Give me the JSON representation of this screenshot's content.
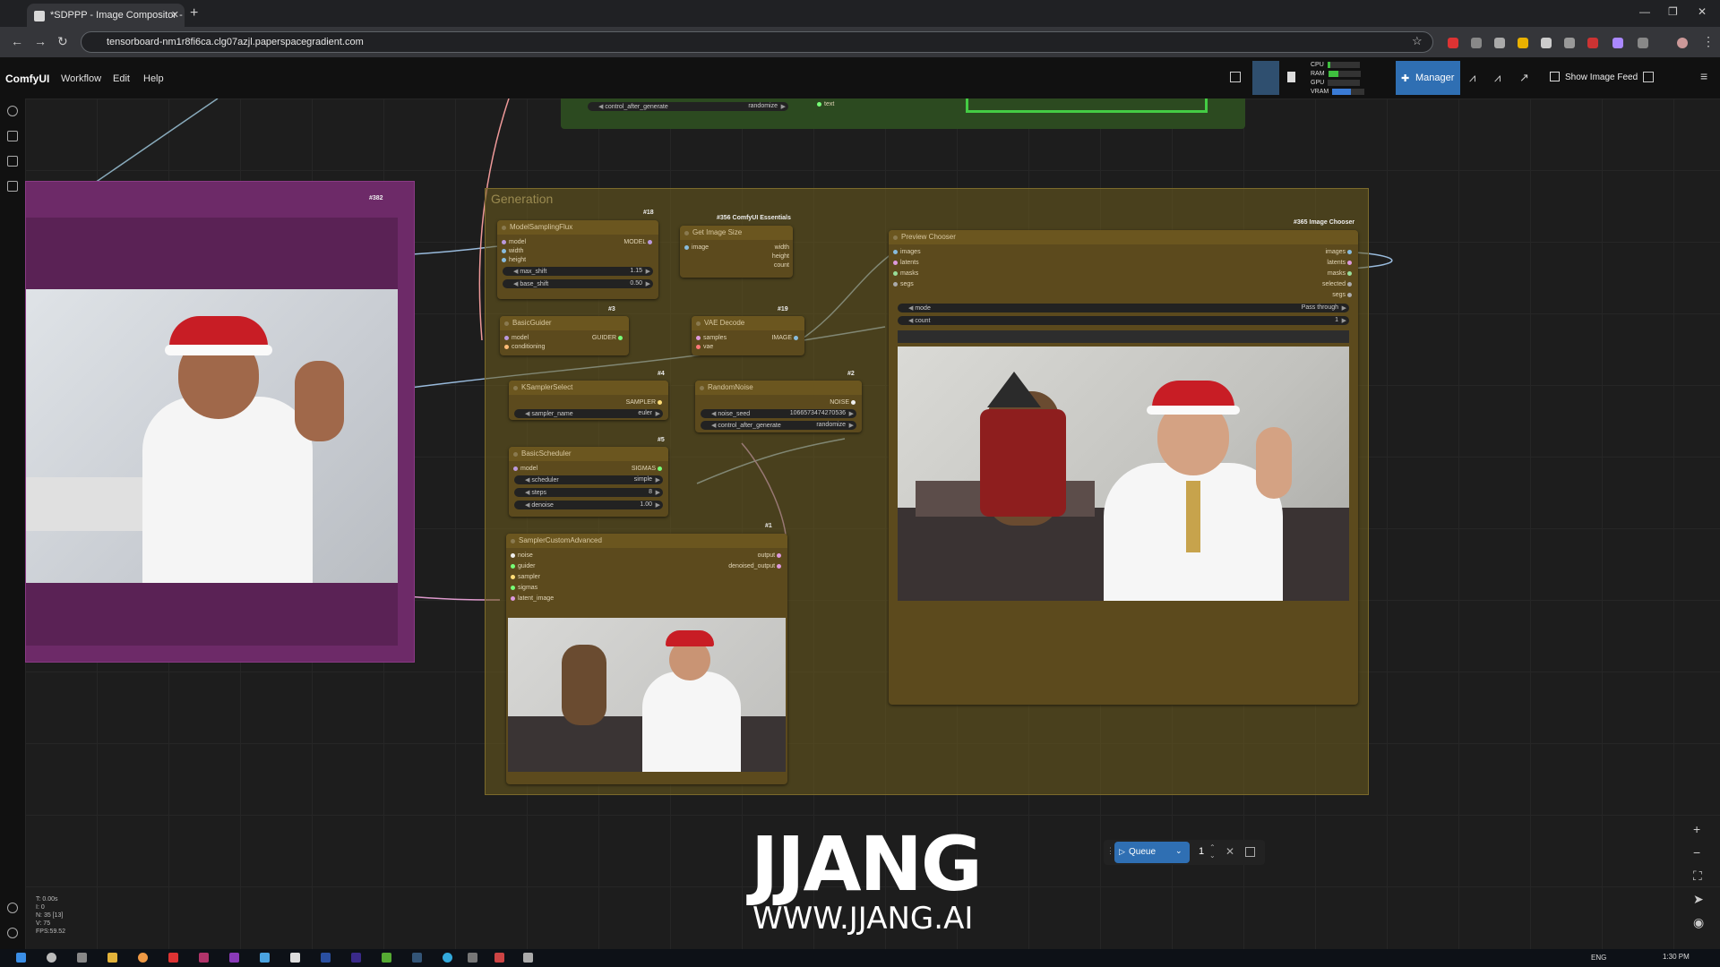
{
  "browser": {
    "tab_title": "*SDPPP - Image Compositor - C",
    "url": "tensorboard-nm1r8fi6ca.clg07azjl.paperspacegradient.com"
  },
  "menu": {
    "logo": "ComfyUI",
    "items": [
      "Workflow",
      "Edit",
      "Help"
    ],
    "stats": [
      {
        "label": "CPU",
        "value": "9%",
        "fraction": 0.09,
        "color": "#3fbf3f"
      },
      {
        "label": "RAM",
        "value": "32%",
        "fraction": 0.32,
        "color": "#3fbf3f"
      },
      {
        "label": "GPU",
        "value": "0%",
        "fraction": 0.0,
        "color": "#3fbf3f"
      },
      {
        "label": "VRAM",
        "value": "58%",
        "fraction": 0.58,
        "color": "#3a7bd5"
      }
    ],
    "manager_label": "Manager",
    "image_feed_label": "Show Image Feed"
  },
  "top_strip": {
    "control_after_generate": "control_after_generate",
    "control_value": "randomize",
    "text_label": "text"
  },
  "left_node": {
    "id": "#382"
  },
  "generation_group": {
    "title": "Generation"
  },
  "nodes": {
    "model_sampling": {
      "id": "#18",
      "title": "ModelSamplingFlux",
      "inputs": [
        "model",
        "width",
        "height"
      ],
      "output": "MODEL",
      "widgets": [
        {
          "label": "max_shift",
          "value": "1.15"
        },
        {
          "label": "base_shift",
          "value": "0.50"
        }
      ]
    },
    "get_image_size": {
      "id": "#356 ComfyUI Essentials",
      "title": "Get Image Size",
      "inputs": [
        "image"
      ],
      "outputs": [
        "width",
        "height",
        "count"
      ]
    },
    "basic_guider": {
      "id": "#3",
      "title": "BasicGuider",
      "inputs": [
        "model",
        "conditioning"
      ],
      "output": "GUIDER"
    },
    "vae_decode": {
      "id": "#19",
      "title": "VAE Decode",
      "inputs": [
        "samples",
        "vae"
      ],
      "output": "IMAGE"
    },
    "ksampler_select": {
      "id": "#4",
      "title": "KSamplerSelect",
      "output": "SAMPLER",
      "widgets": [
        {
          "label": "sampler_name",
          "value": "euler"
        }
      ]
    },
    "random_noise": {
      "id": "#2",
      "title": "RandomNoise",
      "output": "NOISE",
      "widgets": [
        {
          "label": "noise_seed",
          "value": "1066573474270536"
        },
        {
          "label": "control_after_generate",
          "value": "randomize"
        }
      ]
    },
    "basic_scheduler": {
      "id": "#5",
      "title": "BasicScheduler",
      "inputs": [
        "model"
      ],
      "output": "SIGMAS",
      "widgets": [
        {
          "label": "scheduler",
          "value": "simple"
        },
        {
          "label": "steps",
          "value": "8"
        },
        {
          "label": "denoise",
          "value": "1.00"
        }
      ]
    },
    "sampler_custom": {
      "id": "#1",
      "title": "SamplerCustomAdvanced",
      "inputs": [
        "noise",
        "guider",
        "sampler",
        "sigmas",
        "latent_image"
      ],
      "outputs": [
        "output",
        "denoised_output"
      ]
    },
    "preview_chooser": {
      "id": "#365 Image Chooser",
      "title": "Preview Chooser",
      "inputs": [
        "images",
        "latents",
        "masks",
        "segs"
      ],
      "outputs": [
        "images",
        "latents",
        "masks",
        "selected",
        "segs"
      ],
      "widgets": [
        {
          "label": "mode",
          "value": "Pass through"
        },
        {
          "label": "count",
          "value": "1"
        }
      ]
    }
  },
  "queue": {
    "label": "Queue",
    "count": "1"
  },
  "fps_overlay": [
    "T: 0.00s",
    "I: 0",
    "N: 35 [13]",
    "V: 75",
    "FPS:59.52"
  ],
  "watermark": {
    "logo": "JJANG",
    "url": "WWW.JJANG.AI"
  },
  "taskbar": {
    "lang": "ENG",
    "time": "1:30 PM"
  }
}
